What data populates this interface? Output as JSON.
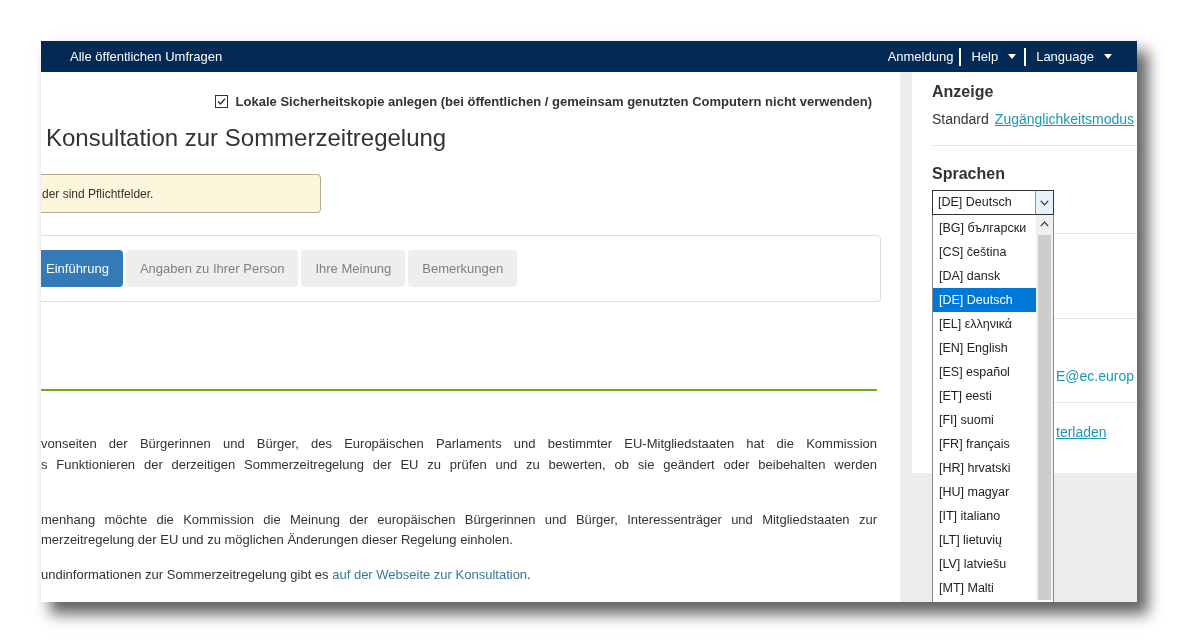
{
  "nav": {
    "title": "Alle öffentlichen Umfragen",
    "links": [
      {
        "label": "Anmeldung",
        "dropdown": false
      },
      {
        "label": "Help",
        "dropdown": true
      },
      {
        "label": "Language",
        "dropdown": true
      }
    ]
  },
  "backup_option": {
    "label": "Lokale Sicherheitskopie anlegen (bei öffentlichen / gemeinsam genutzten Computern nicht verwenden)",
    "checked": true
  },
  "survey_title": "Konsultation zur Sommerzeitregelung",
  "notice": "der sind Pflichtfelder.",
  "tabs": [
    {
      "label": "Einführung",
      "selected": true
    },
    {
      "label": "Angaben zu Ihrer Person",
      "selected": false
    },
    {
      "label": "Ihre Meinung",
      "selected": false
    },
    {
      "label": "Bemerkungen",
      "selected": false
    }
  ],
  "paragraphs": [
    {
      "lines": [
        "vonseiten der Bürgerinnen und Bürger, des Europäischen Parlaments und bestimmter EU-Mitgliedstaaten hat die Kommission",
        "s Funktionieren der derzeitigen Sommerzeitregelung der EU zu prüfen und zu bewerten, ob sie geändert oder beibehalten werden"
      ],
      "continues": true
    },
    {
      "lines": [
        "menhang möchte die Kommission die Meinung der europäischen Bürgerinnen und Bürger, Interessenträger und Mitgliedstaaten zur",
        "merzeitregelung der EU und zu möglichen Änderungen dieser Regelung einholen."
      ],
      "continues": false
    },
    {
      "lines": [
        "undinformationen zur Sommerzeitregelung gibt es"
      ],
      "link": "auf der Webseite zur Konsultation",
      "link_suffix": ".",
      "continues": false
    }
  ],
  "sidebar": {
    "display": {
      "heading": "Anzeige",
      "options": [
        {
          "label": "Standard",
          "selected": true
        },
        {
          "label": "Zugänglichkeitsmodus",
          "selected": false
        }
      ]
    },
    "languages": {
      "heading": "Sprachen",
      "value": "[DE] Deutsch",
      "options": [
        {
          "label": "[BG] български",
          "selected": false
        },
        {
          "label": "[CS] čeština",
          "selected": false
        },
        {
          "label": "[DA] dansk",
          "selected": false
        },
        {
          "label": "[DE] Deutsch",
          "selected": true
        },
        {
          "label": "[EL] ελληνικά",
          "selected": false
        },
        {
          "label": "[EN] English",
          "selected": false
        },
        {
          "label": "[ES] español",
          "selected": false
        },
        {
          "label": "[ET] eesti",
          "selected": false
        },
        {
          "label": "[FI] suomi",
          "selected": false
        },
        {
          "label": "[FR] français",
          "selected": false
        },
        {
          "label": "[HR] hrvatski",
          "selected": false
        },
        {
          "label": "[HU] magyar",
          "selected": false
        },
        {
          "label": "[IT] italiano",
          "selected": false
        },
        {
          "label": "[LT] lietuvių",
          "selected": false
        },
        {
          "label": "[LV] latviešu",
          "selected": false
        },
        {
          "label": "[MT] Malti",
          "selected": false
        }
      ]
    },
    "contact_fragment": "E@ec.europ",
    "download_fragment": "terladen"
  }
}
